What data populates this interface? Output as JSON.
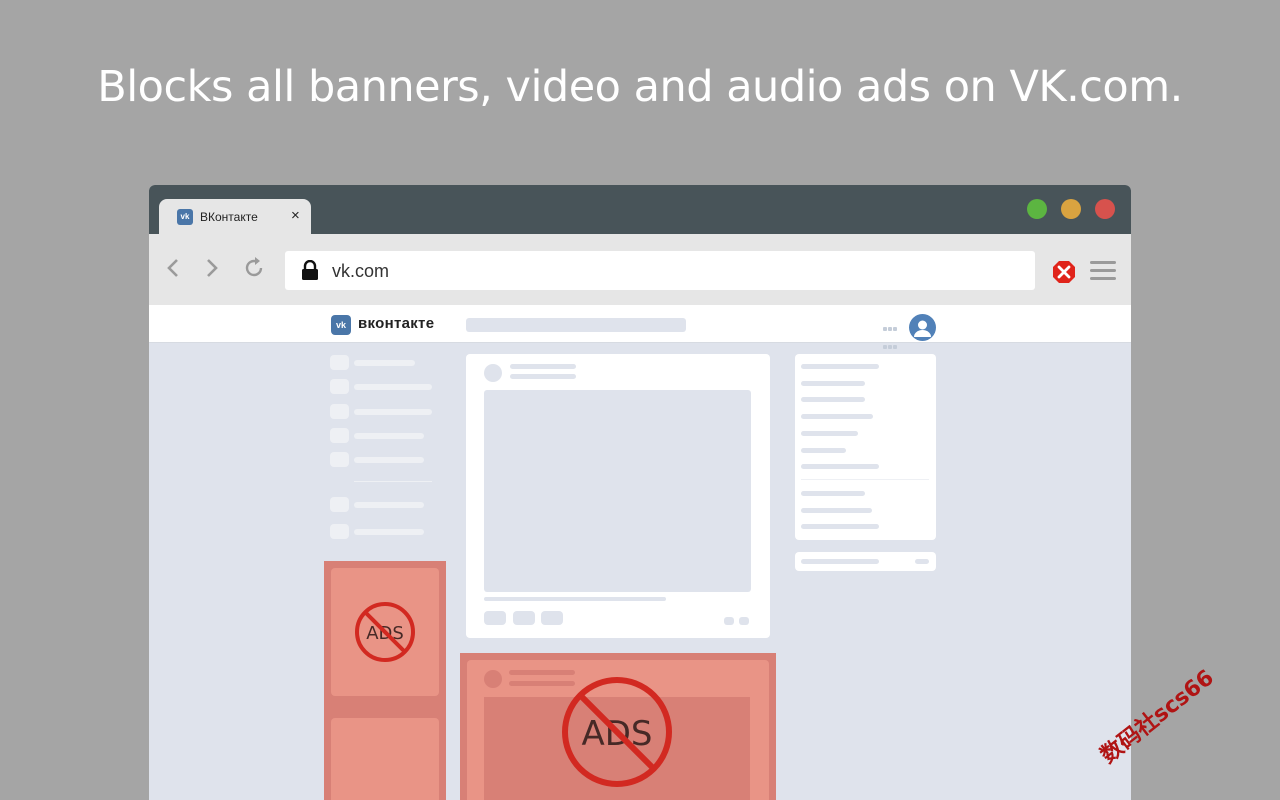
{
  "headline": "Blocks all banners, video and audio ads on VK.com.",
  "browser": {
    "tab": {
      "title": "ВКонтакте",
      "favicon_text": "vk",
      "close": "×"
    },
    "traffic_lights": {
      "green": "#5cb541",
      "yellow": "#d9a340",
      "red": "#d7524d"
    },
    "address": {
      "url": "vk.com",
      "lock_icon": "lock-icon"
    },
    "extension_icon": "blocked-x-icon",
    "menu_icon": "hamburger-menu-icon"
  },
  "vk": {
    "logo_mark": "vk",
    "logo_text": "вконтакте",
    "accent": "#4a76a8",
    "ads_blocked_label_small": "ADS",
    "ads_blocked_label_large": "ADS",
    "ad_zone_color": "#d8786d",
    "block_sign_color": "#d11a10"
  },
  "watermark": "数码社scs66"
}
